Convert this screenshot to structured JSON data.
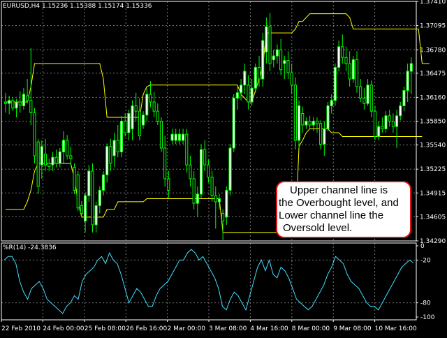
{
  "window": {
    "symbol_header": "EURUSD,H4  1.15236 1.15388 1.15174 1.15336",
    "indicator_header": "%R(14) -24.3836"
  },
  "colors": {
    "background": "#000000",
    "frame": "#ffffff",
    "grid": "#7a7a7a",
    "candle_bull": "#ffffff",
    "candle_bear": "#000000",
    "candle_outline": "#00ff00",
    "channel_line": "#ffff00",
    "wpr_line": "#40e0ff",
    "callout_border": "#e01010"
  },
  "callout": {
    "lines": [
      "Upper channel line is",
      "the Overbought level, and",
      "Lower channel line the",
      "Oversold level."
    ]
  },
  "chart_data": [
    {
      "type": "candlestick",
      "symbol": "EURUSD",
      "timeframe": "H4",
      "ylim": [
        1.3429,
        1.3741
      ],
      "y_ticks": [
        1.3741,
        1.37095,
        1.3678,
        1.36475,
        1.3616,
        1.3585,
        1.3554,
        1.35225,
        1.34915,
        1.34605,
        1.3429
      ],
      "x_tick_labels": [
        "22 Feb 2010",
        "24 Feb 00:00",
        "25 Feb 08:00",
        "26 Feb 16:00",
        "2 Mar 00:00",
        "3 Mar 08:00",
        "4 Mar 16:00",
        "8 Mar 00:00",
        "9 Mar 08:00",
        "10 Mar 16:00"
      ],
      "grid": true,
      "candles": [
        [
          1.361,
          1.3622,
          1.3596,
          1.3608
        ],
        [
          1.3608,
          1.3618,
          1.3594,
          1.3612
        ],
        [
          1.3612,
          1.3616,
          1.3598,
          1.3602
        ],
        [
          1.3602,
          1.3614,
          1.359,
          1.361
        ],
        [
          1.361,
          1.3624,
          1.3596,
          1.3606
        ],
        [
          1.3605,
          1.3628,
          1.36,
          1.362
        ],
        [
          1.3618,
          1.364,
          1.3608,
          1.3612
        ],
        [
          1.3612,
          1.368,
          1.358,
          1.3596
        ],
        [
          1.3596,
          1.3602,
          1.353,
          1.354
        ],
        [
          1.3558,
          1.3562,
          1.349,
          1.35
        ],
        [
          1.3528,
          1.356,
          1.351,
          1.3552
        ],
        [
          1.3542,
          1.3562,
          1.352,
          1.3528
        ],
        [
          1.353,
          1.3536,
          1.352,
          1.3526
        ],
        [
          1.3528,
          1.3545,
          1.352,
          1.3538
        ],
        [
          1.3538,
          1.3548,
          1.3525,
          1.353
        ],
        [
          1.353,
          1.355,
          1.3525,
          1.3545
        ],
        [
          1.3545,
          1.3572,
          1.353,
          1.356
        ],
        [
          1.356,
          1.3567,
          1.3535,
          1.354
        ],
        [
          1.354,
          1.3552,
          1.3528,
          1.3536
        ],
        [
          1.3525,
          1.353,
          1.349,
          1.3495
        ],
        [
          1.3515,
          1.352,
          1.3468,
          1.3472
        ],
        [
          1.3475,
          1.3481,
          1.346,
          1.3465
        ],
        [
          1.3455,
          1.3492,
          1.344,
          1.3488
        ],
        [
          1.3488,
          1.3528,
          1.348,
          1.352
        ],
        [
          1.352,
          1.353,
          1.344,
          1.345
        ],
        [
          1.345,
          1.348,
          1.344,
          1.3475
        ],
        [
          1.3475,
          1.35,
          1.3465,
          1.3495
        ],
        [
          1.3495,
          1.352,
          1.3488,
          1.3515
        ],
        [
          1.3515,
          1.3556,
          1.3505,
          1.3552
        ],
        [
          1.3552,
          1.3562,
          1.352,
          1.353
        ],
        [
          1.354,
          1.357,
          1.3525,
          1.356
        ],
        [
          1.356,
          1.358,
          1.3538,
          1.3545
        ],
        [
          1.3545,
          1.3592,
          1.3538,
          1.3585
        ],
        [
          1.3585,
          1.3595,
          1.3565,
          1.357
        ],
        [
          1.357,
          1.36,
          1.356,
          1.3595
        ],
        [
          1.3575,
          1.3612,
          1.356,
          1.3605
        ],
        [
          1.3605,
          1.3622,
          1.3585,
          1.3598
        ],
        [
          1.3598,
          1.3615,
          1.356,
          1.3566
        ],
        [
          1.358,
          1.3598,
          1.3575,
          1.3593
        ],
        [
          1.3593,
          1.3628,
          1.3585,
          1.362
        ],
        [
          1.362,
          1.3637,
          1.3603,
          1.361
        ],
        [
          1.361,
          1.3623,
          1.359,
          1.3598
        ],
        [
          1.3598,
          1.3608,
          1.358,
          1.3585
        ],
        [
          1.3585,
          1.359,
          1.3545,
          1.355
        ],
        [
          1.355,
          1.3566,
          1.35,
          1.351
        ],
        [
          1.351,
          1.352,
          1.3485,
          1.3495
        ],
        [
          1.356,
          1.3575,
          1.3555,
          1.3568
        ],
        [
          1.356,
          1.3575,
          1.3555,
          1.3568
        ],
        [
          1.356,
          1.3575,
          1.3555,
          1.3568
        ],
        [
          1.356,
          1.3575,
          1.3555,
          1.3568
        ],
        [
          1.3568,
          1.3575,
          1.3518,
          1.3528
        ],
        [
          1.3528,
          1.354,
          1.35,
          1.351
        ],
        [
          1.351,
          1.352,
          1.347,
          1.3478
        ],
        [
          1.3478,
          1.35,
          1.346,
          1.349
        ],
        [
          1.349,
          1.3555,
          1.3485,
          1.3548
        ],
        [
          1.3548,
          1.356,
          1.352,
          1.3528
        ],
        [
          1.3528,
          1.3535,
          1.3505,
          1.3512
        ],
        [
          1.3512,
          1.352,
          1.348,
          1.3488
        ],
        [
          1.3488,
          1.35,
          1.3445,
          1.348
        ],
        [
          1.348,
          1.349,
          1.347,
          1.3484
        ],
        [
          1.3465,
          1.347,
          1.343,
          1.3455
        ],
        [
          1.346,
          1.35,
          1.345,
          1.3495
        ],
        [
          1.3495,
          1.3555,
          1.3488,
          1.355
        ],
        [
          1.355,
          1.362,
          1.3545,
          1.3615
        ],
        [
          1.3615,
          1.363,
          1.36,
          1.3622
        ],
        [
          1.3622,
          1.364,
          1.3612,
          1.3632
        ],
        [
          1.3632,
          1.366,
          1.362,
          1.365
        ],
        [
          1.3632,
          1.3645,
          1.36,
          1.361
        ],
        [
          1.361,
          1.364,
          1.3605,
          1.3628
        ],
        [
          1.3628,
          1.366,
          1.3622,
          1.3655
        ],
        [
          1.3655,
          1.367,
          1.363,
          1.364
        ],
        [
          1.364,
          1.37,
          1.363,
          1.369
        ],
        [
          1.3675,
          1.372,
          1.366,
          1.3708
        ],
        [
          1.3708,
          1.3726,
          1.365,
          1.366
        ],
        [
          1.3665,
          1.3678,
          1.3655,
          1.367
        ],
        [
          1.367,
          1.3685,
          1.366,
          1.3678
        ],
        [
          1.3678,
          1.3692,
          1.3645,
          1.3652
        ],
        [
          1.366,
          1.367,
          1.364,
          1.3664
        ],
        [
          1.3664,
          1.3676,
          1.364,
          1.3648
        ],
        [
          1.3648,
          1.366,
          1.362,
          1.3632
        ],
        [
          1.3632,
          1.3642,
          1.3548,
          1.356
        ],
        [
          1.356,
          1.3612,
          1.355,
          1.3605
        ],
        [
          1.3595,
          1.3604,
          1.357,
          1.358
        ],
        [
          1.358,
          1.359,
          1.3575,
          1.3585
        ],
        [
          1.3585,
          1.3592,
          1.3575,
          1.358
        ],
        [
          1.358,
          1.359,
          1.3572,
          1.3585
        ],
        [
          1.3585,
          1.359,
          1.357,
          1.3582
        ],
        [
          1.3582,
          1.3586,
          1.3548,
          1.3555
        ],
        [
          1.3555,
          1.3585,
          1.354,
          1.3575
        ],
        [
          1.3575,
          1.361,
          1.3572,
          1.3605
        ],
        [
          1.3605,
          1.362,
          1.3595,
          1.3612
        ],
        [
          1.3612,
          1.366,
          1.3605,
          1.3655
        ],
        [
          1.3655,
          1.369,
          1.365,
          1.3682
        ],
        [
          1.3682,
          1.3698,
          1.366,
          1.3668
        ],
        [
          1.3668,
          1.3682,
          1.365,
          1.366
        ],
        [
          1.366,
          1.3676,
          1.363,
          1.364
        ],
        [
          1.364,
          1.367,
          1.3635,
          1.3665
        ],
        [
          1.3665,
          1.3676,
          1.3622,
          1.363
        ],
        [
          1.363,
          1.364,
          1.361,
          1.3615
        ],
        [
          1.3615,
          1.3628,
          1.36,
          1.3608
        ],
        [
          1.3608,
          1.364,
          1.3605,
          1.3632
        ],
        [
          1.3632,
          1.3638,
          1.359,
          1.3598
        ],
        [
          1.3598,
          1.3605,
          1.356,
          1.3565
        ],
        [
          1.3565,
          1.3585,
          1.356,
          1.3578
        ],
        [
          1.3578,
          1.359,
          1.357,
          1.3575
        ],
        [
          1.3575,
          1.3598,
          1.357,
          1.3592
        ],
        [
          1.3592,
          1.36,
          1.3578,
          1.3585
        ],
        [
          1.3585,
          1.3595,
          1.357,
          1.3578
        ],
        [
          1.3578,
          1.36,
          1.355,
          1.3592
        ],
        [
          1.3592,
          1.361,
          1.3586,
          1.3605
        ],
        [
          1.3605,
          1.363,
          1.3598,
          1.3625
        ],
        [
          1.3625,
          1.366,
          1.361,
          1.365
        ],
        [
          1.365,
          1.3668,
          1.362,
          1.366
        ]
      ],
      "upper_channel": [
        1.361,
        1.361,
        1.361,
        1.361,
        1.361,
        1.361,
        1.361,
        1.363,
        1.366,
        1.366,
        1.366,
        1.366,
        1.366,
        1.366,
        1.366,
        1.366,
        1.366,
        1.366,
        1.366,
        1.366,
        1.366,
        1.366,
        1.366,
        1.366,
        1.366,
        1.366,
        1.366,
        1.364,
        1.359,
        1.359,
        1.359,
        1.359,
        1.359,
        1.359,
        1.359,
        1.359,
        1.359,
        1.359,
        1.362,
        1.363,
        1.3632,
        1.3632,
        1.3632,
        1.3632,
        1.3632,
        1.3632,
        1.3632,
        1.3632,
        1.3632,
        1.3632,
        1.3632,
        1.3632,
        1.3632,
        1.3632,
        1.3632,
        1.3632,
        1.3632,
        1.3632,
        1.3632,
        1.3632,
        1.3632,
        1.3632,
        1.3632,
        1.3632,
        1.3632,
        1.362,
        1.3615,
        1.361,
        1.361,
        1.3625,
        1.364,
        1.3655,
        1.37,
        1.37,
        1.37,
        1.37,
        1.37,
        1.37,
        1.37,
        1.37,
        1.3705,
        1.3715,
        1.3715,
        1.372,
        1.3725,
        1.3725,
        1.3725,
        1.3725,
        1.3725,
        1.3725,
        1.3725,
        1.3725,
        1.3725,
        1.3725,
        1.3725,
        1.372,
        1.3705,
        1.3705,
        1.3705,
        1.3705,
        1.3705,
        1.3705,
        1.3705,
        1.3705,
        1.3705,
        1.3705,
        1.3705,
        1.3705,
        1.3705,
        1.3705,
        1.3705,
        1.3705,
        1.3705,
        1.3705,
        1.3705,
        1.366,
        1.366,
        1.366
      ],
      "lower_channel": [
        1.347,
        1.347,
        1.347,
        1.347,
        1.347,
        1.347,
        1.348,
        1.3495,
        1.352,
        1.353,
        1.353,
        1.353,
        1.353,
        1.353,
        1.353,
        1.353,
        1.353,
        1.353,
        1.353,
        1.351,
        1.348,
        1.346,
        1.346,
        1.346,
        1.346,
        1.346,
        1.346,
        1.346,
        1.347,
        1.347,
        1.347,
        1.348,
        1.348,
        1.348,
        1.348,
        1.348,
        1.348,
        1.348,
        1.348,
        1.3484,
        1.3484,
        1.3484,
        1.3484,
        1.3484,
        1.3484,
        1.3484,
        1.3484,
        1.3484,
        1.3484,
        1.3484,
        1.3484,
        1.3484,
        1.3484,
        1.3484,
        1.3484,
        1.3484,
        1.3484,
        1.3484,
        1.3484,
        1.3484,
        1.344,
        1.344,
        1.344,
        1.344,
        1.344,
        1.344,
        1.344,
        1.344,
        1.344,
        1.344,
        1.344,
        1.344,
        1.344,
        1.344,
        1.344,
        1.344,
        1.344,
        1.344,
        1.344,
        1.344,
        1.344,
        1.3552,
        1.356,
        1.357,
        1.3575,
        1.3575,
        1.3575,
        1.3575,
        1.3575,
        1.3575,
        1.357,
        1.357,
        1.357,
        1.3565,
        1.3565,
        1.3565,
        1.3565,
        1.3565,
        1.3565,
        1.3565,
        1.3565,
        1.3565,
        1.3565,
        1.3565,
        1.3565,
        1.3565,
        1.3565,
        1.3565,
        1.3565,
        1.3565,
        1.3565,
        1.3565,
        1.3565,
        1.3565,
        1.3565,
        1.3565
      ]
    },
    {
      "type": "line",
      "title": "%R(14) -24.3836",
      "ylim": [
        -100,
        0
      ],
      "y_ticks": [
        0,
        -20,
        -80,
        -100
      ],
      "series": [
        {
          "name": "%R(14)",
          "values": [
            -20,
            -15,
            -15,
            -25,
            -50,
            -65,
            -75,
            -60,
            -55,
            -50,
            -60,
            -75,
            -80,
            -85,
            -90,
            -95,
            -85,
            -80,
            -70,
            -75,
            -50,
            -40,
            -35,
            -30,
            -20,
            -15,
            -25,
            -10,
            -20,
            -25,
            -40,
            -60,
            -80,
            -70,
            -60,
            -65,
            -75,
            -85,
            -85,
            -70,
            -60,
            -55,
            -50,
            -40,
            -30,
            -20,
            -20,
            -10,
            -5,
            -10,
            -20,
            -15,
            -25,
            -35,
            -45,
            -60,
            -85,
            -90,
            -75,
            -65,
            -70,
            -80,
            -90,
            -70,
            -50,
            -30,
            -20,
            -35,
            -20,
            -40,
            -45,
            -30,
            -35,
            -45,
            -60,
            -75,
            -80,
            -85,
            -90,
            -85,
            -75,
            -65,
            -55,
            -40,
            -30,
            -15,
            -20,
            -25,
            -40,
            -50,
            -55,
            -60,
            -70,
            -80,
            -85,
            -85,
            -90,
            -80,
            -70,
            -60,
            -50,
            -40,
            -30,
            -25,
            -20,
            -24
          ]
        }
      ]
    }
  ]
}
